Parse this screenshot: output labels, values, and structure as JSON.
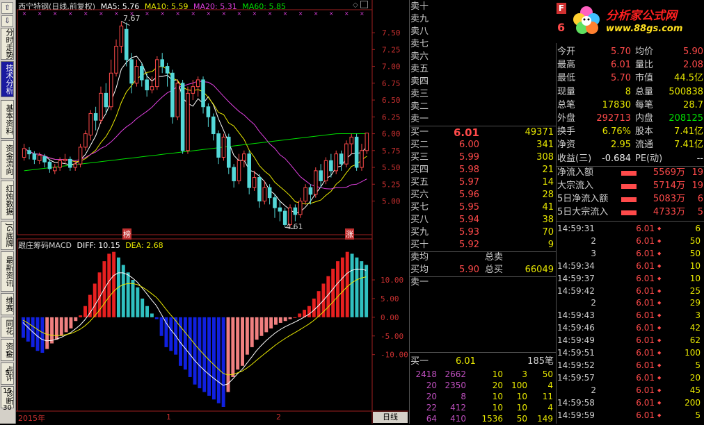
{
  "toolbar": {
    "tabs": [
      "分时走势",
      "技术分析",
      "基本资料",
      "资金流向",
      "红烛数据",
      "JG底牌",
      "最新资讯",
      "维赛",
      "同花",
      "资金",
      "点评",
      "诊断"
    ],
    "active_tab": "技术分析",
    "periods": [
      "1",
      "5",
      "15",
      "30"
    ]
  },
  "chart": {
    "title": "西宁特钢(日线,前复权)",
    "ma": [
      {
        "label": "MA5: 5.76",
        "color": "#ffffff"
      },
      {
        "label": "MA10: 5.59",
        "color": "#e8e800"
      },
      {
        "label": "MA20: 5.31",
        "color": "#e040e0"
      },
      {
        "label": "MA60: 5.85",
        "color": "#00e000"
      }
    ],
    "price_axis": [
      "7.50",
      "7.25",
      "7.00",
      "6.75",
      "6.50",
      "6.25",
      "6.00",
      "5.75",
      "5.50",
      "5.25",
      "5.00"
    ],
    "high_label": "7.67",
    "low_label": "4.61",
    "markers": [
      "榜",
      "涨"
    ],
    "indicator_title": "跟庄筹码MACD",
    "diff_label": "DIFF: 10.15",
    "dea_label": "DEA: 2.68",
    "macd_axis": [
      "10.00",
      "5.00",
      "0.00",
      "-5.00",
      "-10.00"
    ],
    "date_labels": [
      "2015年",
      "1",
      "2"
    ],
    "period_label": "日线",
    "ma_colors": {
      "ma5": "#ffffff",
      "ma10": "#e8e800",
      "ma20": "#e040e0",
      "ma60": "#00e000"
    }
  },
  "chart_data": {
    "type": "candlestick",
    "price_range": [
      4.5,
      7.8
    ],
    "up_color": "#ff4a4a",
    "down_color": "#54d8d8",
    "candles": [
      [
        5.65,
        5.78,
        5.6,
        5.85
      ],
      [
        5.75,
        5.7,
        5.62,
        5.8
      ],
      [
        5.7,
        5.62,
        5.55,
        5.74
      ],
      [
        5.6,
        5.68,
        5.55,
        5.72
      ],
      [
        5.66,
        5.58,
        5.5,
        5.7
      ],
      [
        5.58,
        5.48,
        5.42,
        5.62
      ],
      [
        5.45,
        5.5,
        5.4,
        5.55
      ],
      [
        5.5,
        5.6,
        5.45,
        5.65
      ],
      [
        5.6,
        5.62,
        5.55,
        5.7
      ],
      [
        5.62,
        5.5,
        5.45,
        5.66
      ],
      [
        5.5,
        5.55,
        5.45,
        5.6
      ],
      [
        5.55,
        5.8,
        5.5,
        5.85
      ],
      [
        5.8,
        6.0,
        5.75,
        6.05
      ],
      [
        5.98,
        6.3,
        5.9,
        6.35
      ],
      [
        6.3,
        6.2,
        6.05,
        6.4
      ],
      [
        6.2,
        6.6,
        6.15,
        6.7
      ],
      [
        6.6,
        6.4,
        6.3,
        6.75
      ],
      [
        6.4,
        6.9,
        6.35,
        7.1
      ],
      [
        6.9,
        7.3,
        6.85,
        7.4
      ],
      [
        7.3,
        7.6,
        7.2,
        7.67
      ],
      [
        7.55,
        7.1,
        7.0,
        7.65
      ],
      [
        7.1,
        6.75,
        6.6,
        7.2
      ],
      [
        6.75,
        7.0,
        6.7,
        7.1
      ],
      [
        7.0,
        6.8,
        6.7,
        7.05
      ],
      [
        6.8,
        6.65,
        6.55,
        6.9
      ],
      [
        6.65,
        6.7,
        6.6,
        6.85
      ],
      [
        6.7,
        7.1,
        6.65,
        7.15
      ],
      [
        7.1,
        7.0,
        6.9,
        7.2
      ],
      [
        7.0,
        6.9,
        6.7,
        7.05
      ],
      [
        6.9,
        6.25,
        6.15,
        6.95
      ],
      [
        6.25,
        6.75,
        6.2,
        6.8
      ],
      [
        6.75,
        5.75,
        5.7,
        6.8
      ],
      [
        5.75,
        6.6,
        5.7,
        6.7
      ],
      [
        6.6,
        6.7,
        6.5,
        6.8
      ],
      [
        6.7,
        6.8,
        6.55,
        6.85
      ],
      [
        6.8,
        6.4,
        6.3,
        6.85
      ],
      [
        6.4,
        6.25,
        6.1,
        6.45
      ],
      [
        6.25,
        6.0,
        5.9,
        6.3
      ],
      [
        6.0,
        5.65,
        5.55,
        6.05
      ],
      [
        5.65,
        5.95,
        5.6,
        6.0
      ],
      [
        5.95,
        5.5,
        5.4,
        6.0
      ],
      [
        5.5,
        5.3,
        5.2,
        5.55
      ],
      [
        5.3,
        5.6,
        5.25,
        5.7
      ],
      [
        5.6,
        5.7,
        5.5,
        5.75
      ],
      [
        5.7,
        5.2,
        5.1,
        5.75
      ],
      [
        5.2,
        5.35,
        5.15,
        5.45
      ],
      [
        5.35,
        5.0,
        4.9,
        5.4
      ],
      [
        5.0,
        5.2,
        4.95,
        5.3
      ],
      [
        5.2,
        5.05,
        4.95,
        5.25
      ],
      [
        5.05,
        4.9,
        4.75,
        5.1
      ],
      [
        4.9,
        4.85,
        4.7,
        5.0
      ],
      [
        4.85,
        4.65,
        4.61,
        4.9
      ],
      [
        4.65,
        4.9,
        4.62,
        4.95
      ],
      [
        4.9,
        4.8,
        4.7,
        4.95
      ],
      [
        4.8,
        5.0,
        4.75,
        5.05
      ],
      [
        5.0,
        5.2,
        4.95,
        5.25
      ],
      [
        5.2,
        5.1,
        4.95,
        5.25
      ],
      [
        5.1,
        5.45,
        5.05,
        5.5
      ],
      [
        5.45,
        5.3,
        5.2,
        5.55
      ],
      [
        5.3,
        5.6,
        5.25,
        5.65
      ],
      [
        5.6,
        5.45,
        5.35,
        5.7
      ],
      [
        5.45,
        5.7,
        5.4,
        5.75
      ],
      [
        5.7,
        5.55,
        5.45,
        5.75
      ],
      [
        5.55,
        5.85,
        5.5,
        5.9
      ],
      [
        5.85,
        5.95,
        5.7,
        6.0
      ],
      [
        5.95,
        5.5,
        5.45,
        6.0
      ],
      [
        5.5,
        5.75,
        5.45,
        5.85
      ],
      [
        5.75,
        6.01,
        5.7,
        6.01
      ]
    ],
    "macd": [
      -5.5,
      -6.5,
      -8,
      -9,
      -9.5,
      -8.5,
      -7,
      -6,
      -5,
      -4,
      -3,
      -1,
      0.5,
      3,
      6,
      9,
      12,
      15,
      17,
      17.5,
      16,
      14,
      12,
      10,
      8,
      5,
      3,
      1,
      -0.5,
      -5,
      -8,
      -9,
      -10,
      -13,
      -14,
      -16,
      -18,
      -19,
      -20,
      -21,
      -22,
      -23,
      -24,
      -20,
      -16,
      -14,
      -13,
      -10,
      -8,
      -6,
      -5,
      -4,
      -3,
      -2,
      -1.5,
      -1,
      -0.5,
      0,
      1,
      2,
      3,
      5,
      7,
      9,
      11,
      13,
      15,
      16,
      17.5,
      17,
      16,
      15,
      14
    ],
    "macd_range": [
      -24,
      18
    ]
  },
  "book": {
    "sell_labels": [
      "卖十",
      "卖九",
      "卖八",
      "卖七",
      "卖六",
      "卖五",
      "卖四",
      "卖三",
      "卖二",
      "卖一"
    ],
    "buy": [
      {
        "label": "买一",
        "price": "6.01",
        "vol": "49371"
      },
      {
        "label": "买二",
        "price": "6.00",
        "vol": "341"
      },
      {
        "label": "买三",
        "price": "5.99",
        "vol": "308"
      },
      {
        "label": "买四",
        "price": "5.98",
        "vol": "21"
      },
      {
        "label": "买五",
        "price": "5.97",
        "vol": "14"
      },
      {
        "label": "买六",
        "price": "5.96",
        "vol": "28"
      },
      {
        "label": "买七",
        "price": "5.95",
        "vol": "41"
      },
      {
        "label": "买八",
        "price": "5.94",
        "vol": "38"
      },
      {
        "label": "买九",
        "price": "5.93",
        "vol": "70"
      },
      {
        "label": "买十",
        "price": "5.92",
        "vol": "9"
      }
    ],
    "sell_avg_label": "卖均",
    "total_sell_label": "总卖",
    "buy_avg_label": "买均",
    "buy_avg": "5.90",
    "total_buy_label": "总买",
    "total_buy": "66049",
    "sell1_label": "卖一",
    "buy1_summary": {
      "label": "买一",
      "price": "6.01",
      "count": "185笔"
    },
    "orders": [
      [
        "2418",
        "2662",
        "10",
        "3",
        "50"
      ],
      [
        "20",
        "2350",
        "20",
        "100",
        "4"
      ],
      [
        "20",
        "8",
        "10",
        "10",
        "11"
      ],
      [
        "22",
        "412",
        "10",
        "10",
        "4"
      ],
      [
        "64",
        "410",
        "1536",
        "50",
        "149"
      ]
    ]
  },
  "info": {
    "logo_text": "分析家公式网",
    "logo_url": "www.88gs.com",
    "f_label": "F",
    "code_fragment": "6",
    "stats": [
      [
        "今开",
        "5.70",
        "均价",
        "5.90"
      ],
      [
        "最高",
        "6.01",
        "量比",
        "2.08"
      ],
      [
        "最低",
        "5.70",
        "市值",
        "44.5亿"
      ],
      [
        "现量",
        "8",
        "总量",
        "500838"
      ],
      [
        "总笔",
        "17830",
        "每笔",
        "28.7"
      ],
      [
        "外盘",
        "292713",
        "内盘",
        "208125"
      ],
      [
        "换手",
        "6.76%",
        "股本",
        "7.41亿"
      ],
      [
        "净资",
        "2.95",
        "流通",
        "7.41亿"
      ],
      [
        "收益(三)",
        "-0.684",
        "PE(动)",
        "--"
      ]
    ],
    "flows": [
      [
        "净流入额",
        "5569万",
        "19"
      ],
      [
        "大宗流入",
        "5714万",
        "19"
      ],
      [
        "5日净流入额",
        "5083万",
        "6"
      ],
      [
        "5日大宗流入",
        "4733万",
        "5"
      ]
    ],
    "ticks": [
      [
        "14:59:31",
        "6.01",
        "6"
      ],
      [
        "2",
        "6.01",
        "50"
      ],
      [
        "3",
        "6.01",
        "50"
      ],
      [
        "14:59:34",
        "6.01",
        "10"
      ],
      [
        "14:59:37",
        "6.01",
        "10"
      ],
      [
        "14:59:42",
        "6.01",
        "25"
      ],
      [
        "2",
        "6.01",
        "29"
      ],
      [
        "14:59:43",
        "6.01",
        "3"
      ],
      [
        "14:59:46",
        "6.01",
        "42"
      ],
      [
        "14:59:49",
        "6.01",
        "62"
      ],
      [
        "14:59:51",
        "6.01",
        "100"
      ],
      [
        "14:59:52",
        "6.01",
        "5"
      ],
      [
        "14:59:57",
        "6.01",
        "20"
      ],
      [
        "2",
        "6.01",
        "45"
      ],
      [
        "14:59:58",
        "6.01",
        "200"
      ],
      [
        "14:59:59",
        "6.01",
        "5"
      ]
    ]
  }
}
